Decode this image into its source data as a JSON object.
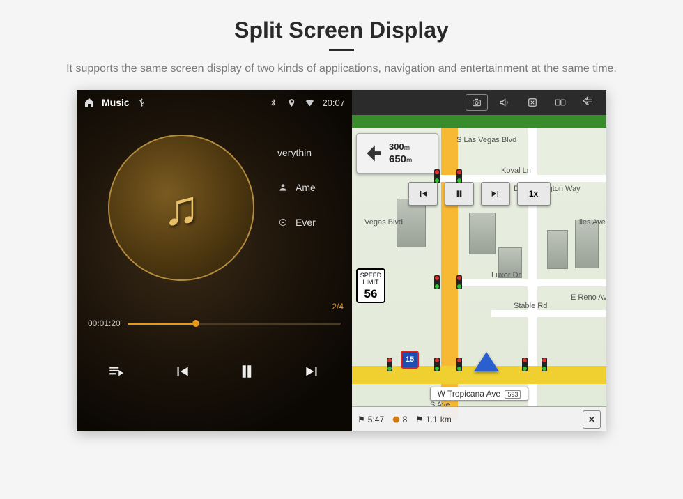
{
  "header": {
    "title": "Split Screen Display",
    "subtitle": "It supports the same screen display of two kinds of applications, navigation and entertainment at the same time."
  },
  "status": {
    "app_label": "Music",
    "time": "20:07"
  },
  "music": {
    "meta": {
      "title_partial": "verythin",
      "artist_partial": "Ame",
      "album_partial": "Ever"
    },
    "track_index": "2/4",
    "elapsed": "00:01:20"
  },
  "nav": {
    "turn": {
      "dist_secondary": "300",
      "dist_secondary_unit": "m",
      "dist_primary": "650",
      "dist_primary_unit": "m"
    },
    "speed_limit": {
      "label_top": "SPEED",
      "label_mid": "LIMIT",
      "value": "56"
    },
    "overlay": {
      "speed": "1x"
    },
    "streets": {
      "s_las_vegas": "S Las Vegas Blvd",
      "koval": "Koval Ln",
      "duke": "Duke Ellington Way",
      "luxor": "Luxor Dr",
      "stable": "Stable Rd",
      "reno": "E Reno Ave",
      "tropicana": "W Tropicana Ave",
      "s_ave": "S Ave",
      "iles": "iles Ave",
      "vegas": "Vegas Blvd"
    },
    "exit_tag": "593",
    "route_shield": "15",
    "bottom": {
      "eta": "5:47",
      "dist1": "8",
      "dist2": "1.1",
      "dist2_unit": "km"
    }
  }
}
